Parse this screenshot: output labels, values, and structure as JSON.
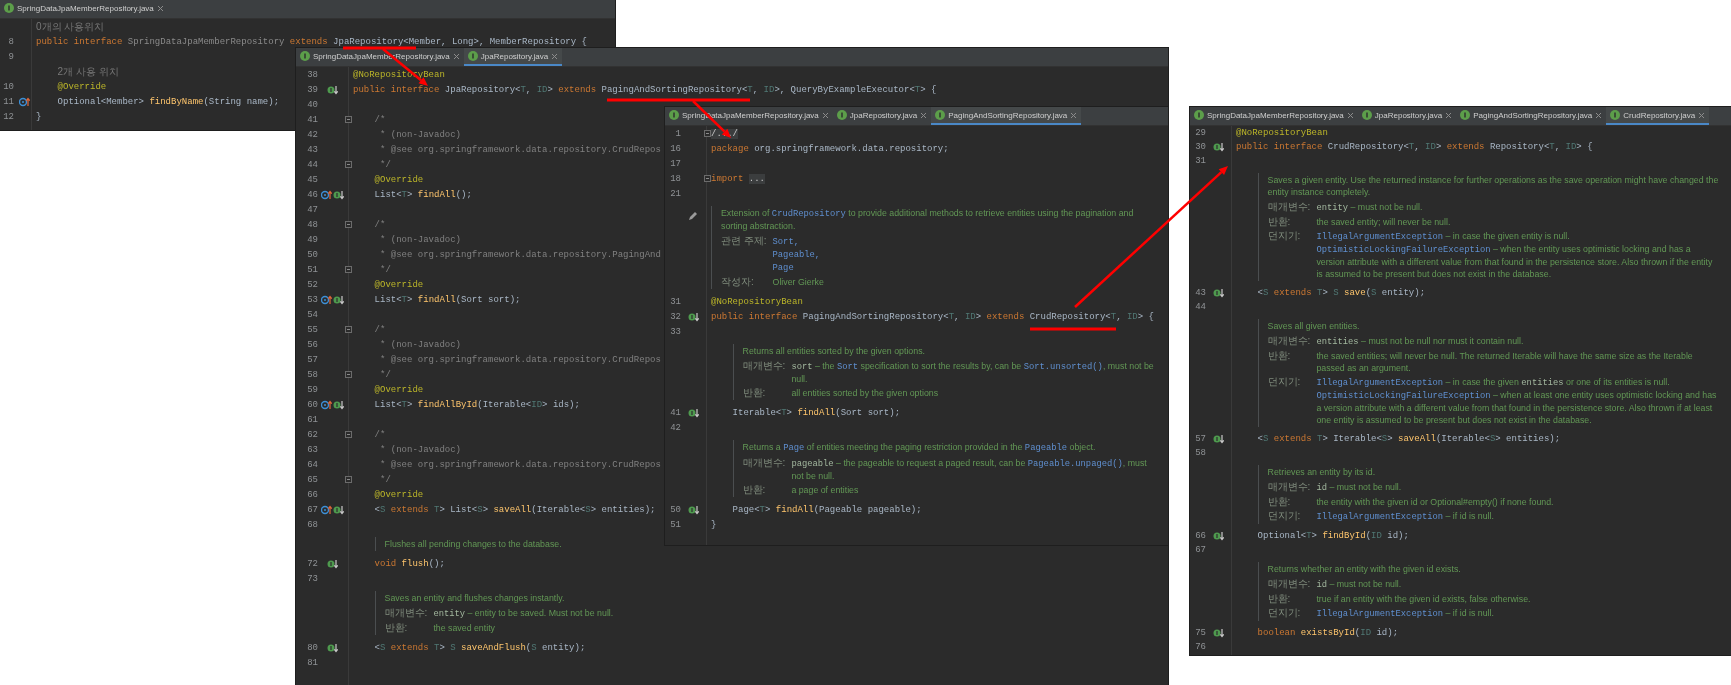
{
  "panels": [
    {
      "tabs": [
        {
          "label": "SpringDataJpaMemberRepository.java",
          "selected": false
        }
      ],
      "lines": [
        {
          "kind": "hint",
          "text": "0개의 사용위치"
        },
        {
          "kind": "code",
          "number": "8",
          "tokens": [
            {
              "kind": "keyword",
              "text": "public interface "
            },
            {
              "kind": "unused",
              "text": "SpringDataJpaMemberRepository "
            },
            {
              "kind": "keyword",
              "text": "extends "
            },
            {
              "kind": "plain",
              "text": "JpaRepository<Member, Long>, MemberRepository {"
            }
          ]
        },
        {
          "kind": "code",
          "number": "9"
        },
        {
          "kind": "hint",
          "inner": true,
          "text": "2개 사용 위치"
        },
        {
          "kind": "code",
          "number": "10",
          "inner": true,
          "tokens": [
            {
              "kind": "annotation",
              "text": "@Override"
            }
          ]
        },
        {
          "kind": "code",
          "number": "11",
          "icons": [
            {
              "kind": "up"
            }
          ],
          "inner": true,
          "tokens": [
            {
              "kind": "plain",
              "text": "Optional<Member> "
            },
            {
              "kind": "method",
              "text": "findByName"
            },
            {
              "kind": "plain",
              "text": "(String name);"
            }
          ]
        },
        {
          "kind": "code",
          "number": "12",
          "tokens": [
            {
              "kind": "plain",
              "text": "}"
            }
          ]
        }
      ]
    },
    {
      "tabs": [
        {
          "label": "SpringDataJpaMemberRepository.java",
          "selected": false
        },
        {
          "label": "JpaRepository.java",
          "selected": true
        }
      ],
      "lines": [
        {
          "kind": "code",
          "number": "38",
          "tokens": [
            {
              "kind": "annotation",
              "text": "@NoRepositoryBean"
            }
          ]
        },
        {
          "kind": "code",
          "number": "39",
          "icons": [
            {
              "kind": "down"
            }
          ],
          "tokens": [
            {
              "kind": "keyword",
              "text": "public interface "
            },
            {
              "kind": "plain",
              "text": "JpaRepository<"
            },
            {
              "kind": "typeparam",
              "text": "T"
            },
            {
              "kind": "plain",
              "text": ", "
            },
            {
              "kind": "typeparam",
              "text": "ID"
            },
            {
              "kind": "plain",
              "text": "> "
            },
            {
              "kind": "keyword",
              "text": "extends "
            },
            {
              "kind": "plain",
              "text": "PagingAndSortingRepository<"
            },
            {
              "kind": "typeparam",
              "text": "T"
            },
            {
              "kind": "plain",
              "text": ", "
            },
            {
              "kind": "typeparam",
              "text": "ID"
            },
            {
              "kind": "plain",
              "text": ">, QueryByExampleExecutor<"
            },
            {
              "kind": "typeparam",
              "text": "T"
            },
            {
              "kind": "plain",
              "text": "> {"
            }
          ]
        },
        {
          "kind": "code",
          "number": "40"
        },
        {
          "kind": "code",
          "number": "41",
          "fold": true,
          "inner": true,
          "tokens": [
            {
              "kind": "comment",
              "text": "/*"
            }
          ]
        },
        {
          "kind": "code",
          "number": "42",
          "inner": true,
          "tokens": [
            {
              "kind": "comment",
              "text": " * (non-Javadoc)"
            }
          ]
        },
        {
          "kind": "code",
          "number": "43",
          "inner": true,
          "tokens": [
            {
              "kind": "comment",
              "text": " * @see org.springframework.data.repository.CrudRepos"
            }
          ]
        },
        {
          "kind": "code",
          "number": "44",
          "fold": true,
          "inner": true,
          "tokens": [
            {
              "kind": "comment",
              "text": " */"
            }
          ]
        },
        {
          "kind": "code",
          "number": "45",
          "inner": true,
          "tokens": [
            {
              "kind": "annotation",
              "text": "@Override"
            }
          ]
        },
        {
          "kind": "code",
          "number": "46",
          "icons": [
            {
              "kind": "up"
            },
            {
              "kind": "down"
            }
          ],
          "inner": true,
          "tokens": [
            {
              "kind": "plain",
              "text": "List<"
            },
            {
              "kind": "typeparam",
              "text": "T"
            },
            {
              "kind": "plain",
              "text": "> "
            },
            {
              "kind": "method",
              "text": "findAll"
            },
            {
              "kind": "plain",
              "text": "();"
            }
          ]
        },
        {
          "kind": "code",
          "number": "47"
        },
        {
          "kind": "code",
          "number": "48",
          "fold": true,
          "inner": true,
          "tokens": [
            {
              "kind": "comment",
              "text": "/*"
            }
          ]
        },
        {
          "kind": "code",
          "number": "49",
          "inner": true,
          "tokens": [
            {
              "kind": "comment",
              "text": " * (non-Javadoc)"
            }
          ]
        },
        {
          "kind": "code",
          "number": "50",
          "inner": true,
          "tokens": [
            {
              "kind": "comment",
              "text": " * @see org.springframework.data.repository.PagingAnd"
            }
          ]
        },
        {
          "kind": "code",
          "number": "51",
          "fold": true,
          "inner": true,
          "tokens": [
            {
              "kind": "comment",
              "text": " */"
            }
          ]
        },
        {
          "kind": "code",
          "number": "52",
          "inner": true,
          "tokens": [
            {
              "kind": "annotation",
              "text": "@Override"
            }
          ]
        },
        {
          "kind": "code",
          "number": "53",
          "icons": [
            {
              "kind": "up"
            },
            {
              "kind": "down"
            }
          ],
          "inner": true,
          "tokens": [
            {
              "kind": "plain",
              "text": "List<"
            },
            {
              "kind": "typeparam",
              "text": "T"
            },
            {
              "kind": "plain",
              "text": "> "
            },
            {
              "kind": "method",
              "text": "findAll"
            },
            {
              "kind": "plain",
              "text": "(Sort sort);"
            }
          ]
        },
        {
          "kind": "code",
          "number": "54"
        },
        {
          "kind": "code",
          "number": "55",
          "fold": true,
          "inner": true,
          "tokens": [
            {
              "kind": "comment",
              "text": "/*"
            }
          ]
        },
        {
          "kind": "code",
          "number": "56",
          "inner": true,
          "tokens": [
            {
              "kind": "comment",
              "text": " * (non-Javadoc)"
            }
          ]
        },
        {
          "kind": "code",
          "number": "57",
          "inner": true,
          "tokens": [
            {
              "kind": "comment",
              "text": " * @see org.springframework.data.repository.CrudRepos"
            }
          ]
        },
        {
          "kind": "code",
          "number": "58",
          "fold": true,
          "inner": true,
          "tokens": [
            {
              "kind": "comment",
              "text": " */"
            }
          ]
        },
        {
          "kind": "code",
          "number": "59",
          "inner": true,
          "tokens": [
            {
              "kind": "annotation",
              "text": "@Override"
            }
          ]
        },
        {
          "kind": "code",
          "number": "60",
          "icons": [
            {
              "kind": "up"
            },
            {
              "kind": "down"
            }
          ],
          "inner": true,
          "tokens": [
            {
              "kind": "plain",
              "text": "List<"
            },
            {
              "kind": "typeparam",
              "text": "T"
            },
            {
              "kind": "plain",
              "text": "> "
            },
            {
              "kind": "method",
              "text": "findAllById"
            },
            {
              "kind": "plain",
              "text": "(Iterable<"
            },
            {
              "kind": "typeparam",
              "text": "ID"
            },
            {
              "kind": "plain",
              "text": "> ids);"
            }
          ]
        },
        {
          "kind": "code",
          "number": "61"
        },
        {
          "kind": "code",
          "number": "62",
          "fold": true,
          "inner": true,
          "tokens": [
            {
              "kind": "comment",
              "text": "/*"
            }
          ]
        },
        {
          "kind": "code",
          "number": "63",
          "inner": true,
          "tokens": [
            {
              "kind": "comment",
              "text": " * (non-Javadoc)"
            }
          ]
        },
        {
          "kind": "code",
          "number": "64",
          "inner": true,
          "tokens": [
            {
              "kind": "comment",
              "text": " * @see org.springframework.data.repository.CrudRepos"
            }
          ]
        },
        {
          "kind": "code",
          "number": "65",
          "fold": true,
          "inner": true,
          "tokens": [
            {
              "kind": "comment",
              "text": " */"
            }
          ]
        },
        {
          "kind": "code",
          "number": "66",
          "inner": true,
          "tokens": [
            {
              "kind": "annotation",
              "text": "@Override"
            }
          ]
        },
        {
          "kind": "code",
          "number": "67",
          "icons": [
            {
              "kind": "up"
            },
            {
              "kind": "down"
            }
          ],
          "inner": true,
          "tokens": [
            {
              "kind": "plain",
              "text": "<"
            },
            {
              "kind": "typeparam",
              "text": "S"
            },
            {
              "kind": "keyword",
              "text": " extends "
            },
            {
              "kind": "typeparam",
              "text": "T"
            },
            {
              "kind": "plain",
              "text": "> List<"
            },
            {
              "kind": "typeparam",
              "text": "S"
            },
            {
              "kind": "plain",
              "text": "> "
            },
            {
              "kind": "method",
              "text": "saveAll"
            },
            {
              "kind": "plain",
              "text": "(Iterable<"
            },
            {
              "kind": "typeparam",
              "text": "S"
            },
            {
              "kind": "plain",
              "text": "> entities);"
            }
          ]
        },
        {
          "kind": "code",
          "number": "68"
        },
        {
          "kind": "doc",
          "inner": true,
          "paragraph": [
            {
              "kind": "text",
              "text": "Flushes all pending changes to the database."
            }
          ]
        },
        {
          "kind": "code",
          "number": "72",
          "icons": [
            {
              "kind": "down"
            }
          ],
          "inner": true,
          "tokens": [
            {
              "kind": "keyword",
              "text": "void "
            },
            {
              "kind": "method",
              "text": "flush"
            },
            {
              "kind": "plain",
              "text": "();"
            }
          ]
        },
        {
          "kind": "code",
          "number": "73"
        },
        {
          "kind": "doc",
          "inner": true,
          "paragraph": [
            {
              "kind": "text",
              "text": "Saves an entity and flushes changes instantly."
            }
          ],
          "rows": [
            {
              "label": "매개변수:",
              "lines": [
                [
                  {
                    "kind": "code",
                    "text": "entity"
                  },
                  {
                    "kind": "text",
                    "text": " – entity to be saved. Must not be null."
                  }
                ]
              ]
            },
            {
              "label": "반환:",
              "lines": [
                [
                  {
                    "kind": "text",
                    "text": "the saved entity"
                  }
                ]
              ]
            }
          ]
        },
        {
          "kind": "code",
          "number": "80",
          "icons": [
            {
              "kind": "down"
            }
          ],
          "inner": true,
          "tokens": [
            {
              "kind": "plain",
              "text": "<"
            },
            {
              "kind": "typeparam",
              "text": "S"
            },
            {
              "kind": "keyword",
              "text": " extends "
            },
            {
              "kind": "typeparam",
              "text": "T"
            },
            {
              "kind": "plain",
              "text": "> "
            },
            {
              "kind": "typeparam",
              "text": "S"
            },
            {
              "kind": "method",
              "text": " saveAndFlush"
            },
            {
              "kind": "plain",
              "text": "("
            },
            {
              "kind": "typeparam",
              "text": "S"
            },
            {
              "kind": "plain",
              "text": " entity);"
            }
          ]
        },
        {
          "kind": "code",
          "number": "81"
        }
      ]
    },
    {
      "tabs": [
        {
          "label": "SpringDataJpaMemberRepository.java",
          "selected": false
        },
        {
          "label": "JpaRepository.java",
          "selected": false
        },
        {
          "label": "PagingAndSortingRepository.java",
          "selected": true
        }
      ],
      "lines": [
        {
          "kind": "code",
          "number": "1",
          "fold": true,
          "tokens": [
            {
              "kind": "folded",
              "text": "/.../"
            }
          ]
        },
        {
          "kind": "code",
          "number": "16",
          "tokens": [
            {
              "kind": "keyword",
              "text": "package "
            },
            {
              "kind": "plain",
              "text": "org.springframework.data.repository;"
            }
          ]
        },
        {
          "kind": "code",
          "number": "17"
        },
        {
          "kind": "code",
          "number": "18",
          "fold": true,
          "tokens": [
            {
              "kind": "keyword",
              "text": "import "
            },
            {
              "kind": "folded",
              "text": "..."
            }
          ]
        },
        {
          "kind": "code",
          "number": "21"
        },
        {
          "kind": "doc",
          "icons": [
            {
              "kind": "edit"
            }
          ],
          "paragraph": [
            {
              "kind": "text",
              "text": "Extension of "
            },
            {
              "kind": "link",
              "text": "CrudRepository"
            },
            {
              "kind": "text",
              "text": " to provide additional methods to retrieve entities using the pagination and sorting abstraction."
            }
          ],
          "rows": [
            {
              "label": "관련 주제:",
              "lines": [
                [
                  {
                    "kind": "link",
                    "text": "Sort,"
                  }
                ],
                [
                  {
                    "kind": "link",
                    "text": "Pageable,"
                  }
                ],
                [
                  {
                    "kind": "link",
                    "text": "Page"
                  }
                ]
              ]
            },
            {
              "label": "작성자:",
              "lines": [
                [
                  {
                    "kind": "text",
                    "text": "Oliver Gierke"
                  }
                ]
              ]
            }
          ]
        },
        {
          "kind": "code",
          "number": "31",
          "tokens": [
            {
              "kind": "annotation",
              "text": "@NoRepositoryBean"
            }
          ]
        },
        {
          "kind": "code",
          "number": "32",
          "icons": [
            {
              "kind": "down"
            }
          ],
          "tokens": [
            {
              "kind": "keyword",
              "text": "public interface "
            },
            {
              "kind": "plain",
              "text": "PagingAndSortingRepository<"
            },
            {
              "kind": "typeparam",
              "text": "T"
            },
            {
              "kind": "plain",
              "text": ", "
            },
            {
              "kind": "typeparam",
              "text": "ID"
            },
            {
              "kind": "plain",
              "text": "> "
            },
            {
              "kind": "keyword",
              "text": "extends "
            },
            {
              "kind": "plain",
              "text": "CrudRepository<"
            },
            {
              "kind": "typeparam",
              "text": "T"
            },
            {
              "kind": "plain",
              "text": ", "
            },
            {
              "kind": "typeparam",
              "text": "ID"
            },
            {
              "kind": "plain",
              "text": "> {"
            }
          ]
        },
        {
          "kind": "code",
          "number": "33"
        },
        {
          "kind": "doc",
          "inner": true,
          "paragraph": [
            {
              "kind": "text",
              "text": "Returns all entities sorted by the given options."
            }
          ],
          "rows": [
            {
              "label": "매개변수:",
              "lines": [
                [
                  {
                    "kind": "code",
                    "text": "sort"
                  },
                  {
                    "kind": "text",
                    "text": " – the "
                  },
                  {
                    "kind": "link",
                    "text": "Sort"
                  },
                  {
                    "kind": "text",
                    "text": " specification to sort the results by, can be "
                  },
                  {
                    "kind": "link",
                    "text": "Sort.unsorted()"
                  },
                  {
                    "kind": "text",
                    "text": ", must not be null."
                  }
                ]
              ]
            },
            {
              "label": "반환:",
              "lines": [
                [
                  {
                    "kind": "text",
                    "text": "all entities sorted by the given options"
                  }
                ]
              ]
            }
          ]
        },
        {
          "kind": "code",
          "number": "41",
          "icons": [
            {
              "kind": "down"
            }
          ],
          "inner": true,
          "tokens": [
            {
              "kind": "plain",
              "text": "Iterable<"
            },
            {
              "kind": "typeparam",
              "text": "T"
            },
            {
              "kind": "plain",
              "text": "> "
            },
            {
              "kind": "method",
              "text": "findAll"
            },
            {
              "kind": "plain",
              "text": "(Sort sort);"
            }
          ]
        },
        {
          "kind": "code",
          "number": "42"
        },
        {
          "kind": "doc",
          "inner": true,
          "paragraph": [
            {
              "kind": "text",
              "text": "Returns a "
            },
            {
              "kind": "link",
              "text": "Page"
            },
            {
              "kind": "text",
              "text": " of entities meeting the paging restriction provided in the "
            },
            {
              "kind": "link",
              "text": "Pageable"
            },
            {
              "kind": "text",
              "text": " object."
            }
          ],
          "rows": [
            {
              "label": "매개변수:",
              "lines": [
                [
                  {
                    "kind": "code",
                    "text": "pageable"
                  },
                  {
                    "kind": "text",
                    "text": " – the pageable to request a paged result, can be "
                  },
                  {
                    "kind": "link",
                    "text": "Pageable.unpaged()"
                  },
                  {
                    "kind": "text",
                    "text": ", must not be null."
                  }
                ]
              ]
            },
            {
              "label": "반환:",
              "lines": [
                [
                  {
                    "kind": "text",
                    "text": "a page of entities"
                  }
                ]
              ]
            }
          ]
        },
        {
          "kind": "code",
          "number": "50",
          "icons": [
            {
              "kind": "down"
            }
          ],
          "inner": true,
          "tokens": [
            {
              "kind": "plain",
              "text": "Page<"
            },
            {
              "kind": "typeparam",
              "text": "T"
            },
            {
              "kind": "plain",
              "text": "> "
            },
            {
              "kind": "method",
              "text": "findAll"
            },
            {
              "kind": "plain",
              "text": "(Pageable pageable);"
            }
          ]
        },
        {
          "kind": "code",
          "number": "51",
          "tokens": [
            {
              "kind": "plain",
              "text": "}"
            }
          ]
        }
      ]
    },
    {
      "tabs": [
        {
          "label": "SpringDataJpaMemberRepository.java",
          "selected": false
        },
        {
          "label": "JpaRepository.java",
          "selected": false
        },
        {
          "label": "PagingAndSortingRepository.java",
          "selected": false
        },
        {
          "label": "CrudRepository.java",
          "selected": true
        }
      ],
      "lines": [
        {
          "kind": "code",
          "number": "29",
          "tokens": [
            {
              "kind": "annotation",
              "text": "@NoRepositoryBean"
            }
          ]
        },
        {
          "kind": "code",
          "number": "30",
          "icons": [
            {
              "kind": "down"
            }
          ],
          "tokens": [
            {
              "kind": "keyword",
              "text": "public interface "
            },
            {
              "kind": "plain",
              "text": "CrudRepository<"
            },
            {
              "kind": "typeparam",
              "text": "T"
            },
            {
              "kind": "plain",
              "text": ", "
            },
            {
              "kind": "typeparam",
              "text": "ID"
            },
            {
              "kind": "plain",
              "text": "> "
            },
            {
              "kind": "keyword",
              "text": "extends "
            },
            {
              "kind": "plain",
              "text": "Repository<"
            },
            {
              "kind": "typeparam",
              "text": "T"
            },
            {
              "kind": "plain",
              "text": ", "
            },
            {
              "kind": "typeparam",
              "text": "ID"
            },
            {
              "kind": "plain",
              "text": "> {"
            }
          ]
        },
        {
          "kind": "code",
          "number": "31"
        },
        {
          "kind": "doc",
          "inner": true,
          "paragraph": [
            {
              "kind": "text",
              "text": "Saves a given entity. Use the returned instance for further operations as the save operation might have changed the entity instance completely."
            }
          ],
          "rows": [
            {
              "label": "매개변수:",
              "lines": [
                [
                  {
                    "kind": "code",
                    "text": "entity"
                  },
                  {
                    "kind": "text",
                    "text": " – must not be null."
                  }
                ]
              ]
            },
            {
              "label": "반환:",
              "lines": [
                [
                  {
                    "kind": "text",
                    "text": "the saved entity; will never be null."
                  }
                ]
              ]
            },
            {
              "label": "던지기:",
              "lines": [
                [
                  {
                    "kind": "link",
                    "text": "IllegalArgumentException"
                  },
                  {
                    "kind": "text",
                    "text": " – in case the given entity is null."
                  }
                ],
                [
                  {
                    "kind": "link",
                    "text": "OptimisticLockingFailureException"
                  },
                  {
                    "kind": "text",
                    "text": " – when the entity uses optimistic locking and has a version attribute with a different value from that found in the persistence store. Also thrown if the entity is assumed to be present but does not exist in the database."
                  }
                ]
              ]
            }
          ]
        },
        {
          "kind": "code",
          "number": "43",
          "icons": [
            {
              "kind": "down"
            }
          ],
          "inner": true,
          "tokens": [
            {
              "kind": "plain",
              "text": "<"
            },
            {
              "kind": "typeparam",
              "text": "S"
            },
            {
              "kind": "keyword",
              "text": " extends "
            },
            {
              "kind": "typeparam",
              "text": "T"
            },
            {
              "kind": "plain",
              "text": "> "
            },
            {
              "kind": "typeparam",
              "text": "S"
            },
            {
              "kind": "method",
              "text": " save"
            },
            {
              "kind": "plain",
              "text": "("
            },
            {
              "kind": "typeparam",
              "text": "S"
            },
            {
              "kind": "plain",
              "text": " entity);"
            }
          ]
        },
        {
          "kind": "code",
          "number": "44"
        },
        {
          "kind": "doc",
          "inner": true,
          "paragraph": [
            {
              "kind": "text",
              "text": "Saves all given entities."
            }
          ],
          "rows": [
            {
              "label": "매개변수:",
              "lines": [
                [
                  {
                    "kind": "code",
                    "text": "entities"
                  },
                  {
                    "kind": "text",
                    "text": " – must not be null nor must it contain null."
                  }
                ]
              ]
            },
            {
              "label": "반환:",
              "lines": [
                [
                  {
                    "kind": "text",
                    "text": "the saved entities; will never be null. The returned Iterable will have the same size as the Iterable passed as an argument."
                  }
                ]
              ]
            },
            {
              "label": "던지기:",
              "lines": [
                [
                  {
                    "kind": "link",
                    "text": "IllegalArgumentException"
                  },
                  {
                    "kind": "text",
                    "text": " – in case the given "
                  },
                  {
                    "kind": "code",
                    "text": "entities"
                  },
                  {
                    "kind": "text",
                    "text": " or one of its entities is null."
                  }
                ],
                [
                  {
                    "kind": "link",
                    "text": "OptimisticLockingFailureException"
                  },
                  {
                    "kind": "text",
                    "text": " – when at least one entity uses optimistic locking and has a version attribute with a different value from that found in the persistence store. Also thrown if at least one entity is assumed to be present but does not exist in the database."
                  }
                ]
              ]
            }
          ]
        },
        {
          "kind": "code",
          "number": "57",
          "icons": [
            {
              "kind": "down"
            }
          ],
          "inner": true,
          "tokens": [
            {
              "kind": "plain",
              "text": "<"
            },
            {
              "kind": "typeparam",
              "text": "S"
            },
            {
              "kind": "keyword",
              "text": " extends "
            },
            {
              "kind": "typeparam",
              "text": "T"
            },
            {
              "kind": "plain",
              "text": "> Iterable<"
            },
            {
              "kind": "typeparam",
              "text": "S"
            },
            {
              "kind": "plain",
              "text": "> "
            },
            {
              "kind": "method",
              "text": "saveAll"
            },
            {
              "kind": "plain",
              "text": "(Iterable<"
            },
            {
              "kind": "typeparam",
              "text": "S"
            },
            {
              "kind": "plain",
              "text": "> entities);"
            }
          ]
        },
        {
          "kind": "code",
          "number": "58"
        },
        {
          "kind": "doc",
          "inner": true,
          "paragraph": [
            {
              "kind": "text",
              "text": "Retrieves an entity by its id."
            }
          ],
          "rows": [
            {
              "label": "매개변수:",
              "lines": [
                [
                  {
                    "kind": "code",
                    "text": "id"
                  },
                  {
                    "kind": "text",
                    "text": " – must not be null."
                  }
                ]
              ]
            },
            {
              "label": "반환:",
              "lines": [
                [
                  {
                    "kind": "text",
                    "text": "the entity with the given id or Optional#empty() if none found."
                  }
                ]
              ]
            },
            {
              "label": "던지기:",
              "lines": [
                [
                  {
                    "kind": "link",
                    "text": "IllegalArgumentException"
                  },
                  {
                    "kind": "text",
                    "text": " – if id is null."
                  }
                ]
              ]
            }
          ]
        },
        {
          "kind": "code",
          "number": "66",
          "icons": [
            {
              "kind": "down"
            }
          ],
          "inner": true,
          "tokens": [
            {
              "kind": "plain",
              "text": "Optional<"
            },
            {
              "kind": "typeparam",
              "text": "T"
            },
            {
              "kind": "plain",
              "text": "> "
            },
            {
              "kind": "method",
              "text": "findById"
            },
            {
              "kind": "plain",
              "text": "("
            },
            {
              "kind": "typeparam",
              "text": "ID"
            },
            {
              "kind": "plain",
              "text": " id);"
            }
          ]
        },
        {
          "kind": "code",
          "number": "67"
        },
        {
          "kind": "doc",
          "inner": true,
          "paragraph": [
            {
              "kind": "text",
              "text": "Returns whether an entity with the given id exists."
            }
          ],
          "rows": [
            {
              "label": "매개변수:",
              "lines": [
                [
                  {
                    "kind": "code",
                    "text": "id"
                  },
                  {
                    "kind": "text",
                    "text": " – must not be null."
                  }
                ]
              ]
            },
            {
              "label": "반환:",
              "lines": [
                [
                  {
                    "kind": "text",
                    "text": "true if an entity with the given id exists, false otherwise."
                  }
                ]
              ]
            },
            {
              "label": "던지기:",
              "lines": [
                [
                  {
                    "kind": "link",
                    "text": "IllegalArgumentException"
                  },
                  {
                    "kind": "text",
                    "text": " – if id is null."
                  }
                ]
              ]
            }
          ]
        },
        {
          "kind": "code",
          "number": "75",
          "icons": [
            {
              "kind": "down"
            }
          ],
          "inner": true,
          "tokens": [
            {
              "kind": "keyword",
              "text": "boolean "
            },
            {
              "kind": "method",
              "text": "existsById"
            },
            {
              "kind": "plain",
              "text": "("
            },
            {
              "kind": "typeparam",
              "text": "ID"
            },
            {
              "kind": "plain",
              "text": " id);"
            }
          ]
        },
        {
          "kind": "code",
          "number": "76"
        }
      ]
    }
  ]
}
